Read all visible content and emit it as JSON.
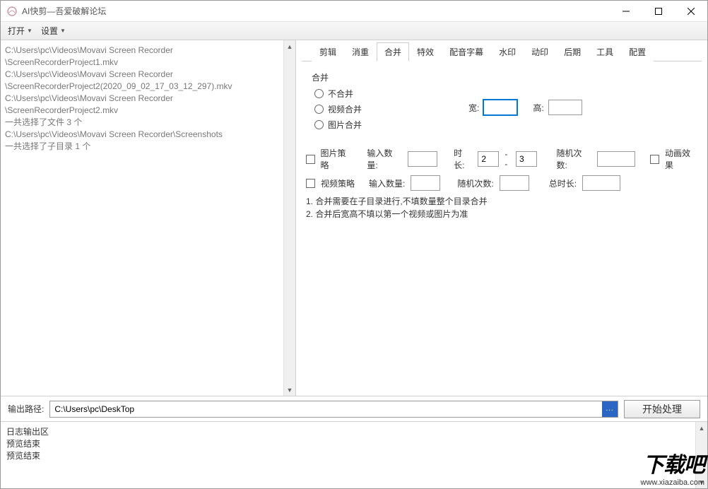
{
  "window": {
    "title": "AI快剪—吾爱破解论坛"
  },
  "menu": {
    "open": "打开",
    "settings": "设置"
  },
  "fileList": [
    "C:\\Users\\pc\\Videos\\Movavi Screen Recorder",
    "\\ScreenRecorderProject1.mkv",
    "C:\\Users\\pc\\Videos\\Movavi Screen Recorder",
    "\\ScreenRecorderProject2(2020_09_02_17_03_12_297).mkv",
    "C:\\Users\\pc\\Videos\\Movavi Screen Recorder",
    "\\ScreenRecorderProject2.mkv",
    "一共选择了文件 3 个",
    "C:\\Users\\pc\\Videos\\Movavi Screen Recorder\\Screenshots",
    "一共选择了子目录 1 个"
  ],
  "tabs": {
    "items": [
      "剪辑",
      "消重",
      "合并",
      "特效",
      "配音字幕",
      "水印",
      "动印",
      "后期",
      "工具",
      "配置"
    ],
    "activeIndex": 2
  },
  "merge": {
    "groupTitle": "合并",
    "options": {
      "none": "不合并",
      "video": "视频合并",
      "image": "图片合并"
    },
    "widthLabel": "宽:",
    "heightLabel": "高:",
    "widthValue": "",
    "heightValue": "",
    "imageStrategy": "图片策略",
    "videoStrategy": "视频策略",
    "inputCount": "输入数量:",
    "duration": "时长:",
    "durationFrom": "2",
    "durationSep": "--",
    "durationTo": "3",
    "randomCount": "随机次数:",
    "animEffect": "动画效果",
    "totalDuration": "总时长:",
    "countVal1": "",
    "randVal1": "",
    "countVal2": "",
    "randVal2": "",
    "totalVal": "",
    "note1": "1. 合并需要在子目录进行,不填数量整个目录合并",
    "note2": "2. 合并后宽高不填以第一个视频或图片为准"
  },
  "output": {
    "label": "输出路径:",
    "path": "C:\\Users\\pc\\DeskTop",
    "browse": "...",
    "start": "开始处理"
  },
  "log": {
    "lines": [
      "日志输出区",
      "预览结束",
      "预览结束"
    ]
  },
  "watermark": {
    "big": "下载吧",
    "url": "www.xiazaiba.com"
  }
}
